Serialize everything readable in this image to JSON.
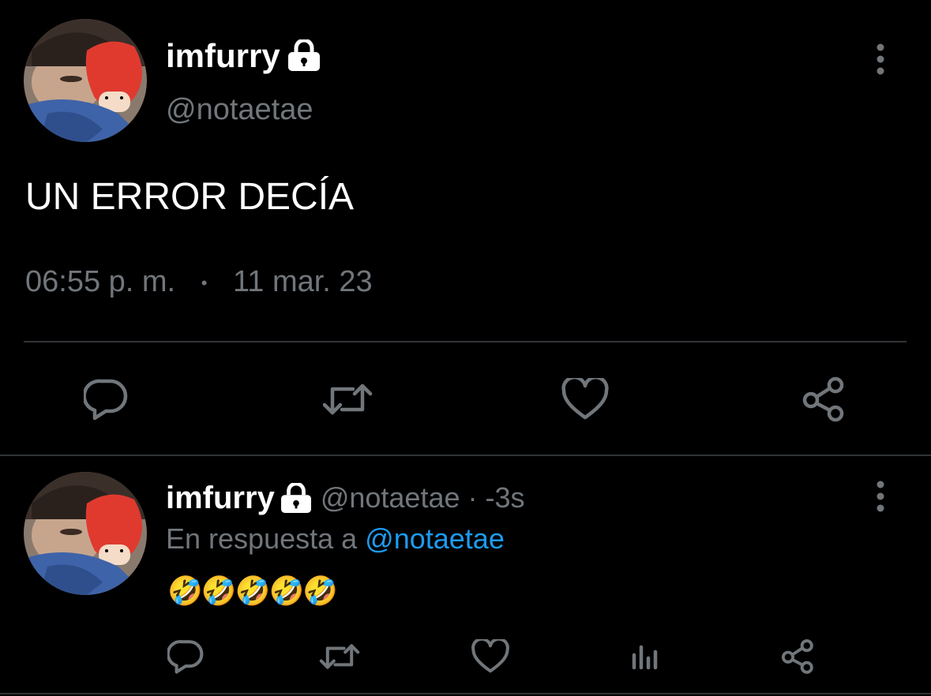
{
  "main_tweet": {
    "display_name": "imfurry",
    "handle": "@notaetae",
    "protected_icon": "lock-icon",
    "text": "UN ERROR DECÍA",
    "time": "06:55 p. m.",
    "separator": "•",
    "date": "11 mar. 23",
    "actions": [
      "reply-icon",
      "retweet-icon",
      "like-icon",
      "share-icon"
    ]
  },
  "reply_tweet": {
    "display_name": "imfurry",
    "handle": "@notaetae",
    "age": "· -3s",
    "in_reply_prefix": "En respuesta a",
    "in_reply_handle": "@notaetae",
    "text": "🤣🤣🤣🤣🤣",
    "actions": [
      "reply-icon",
      "retweet-icon",
      "like-icon",
      "analytics-icon",
      "share-icon"
    ]
  },
  "colors": {
    "background": "#000000",
    "muted": "#71767b",
    "link": "#1d9bf0",
    "divider": "#2f3336"
  }
}
